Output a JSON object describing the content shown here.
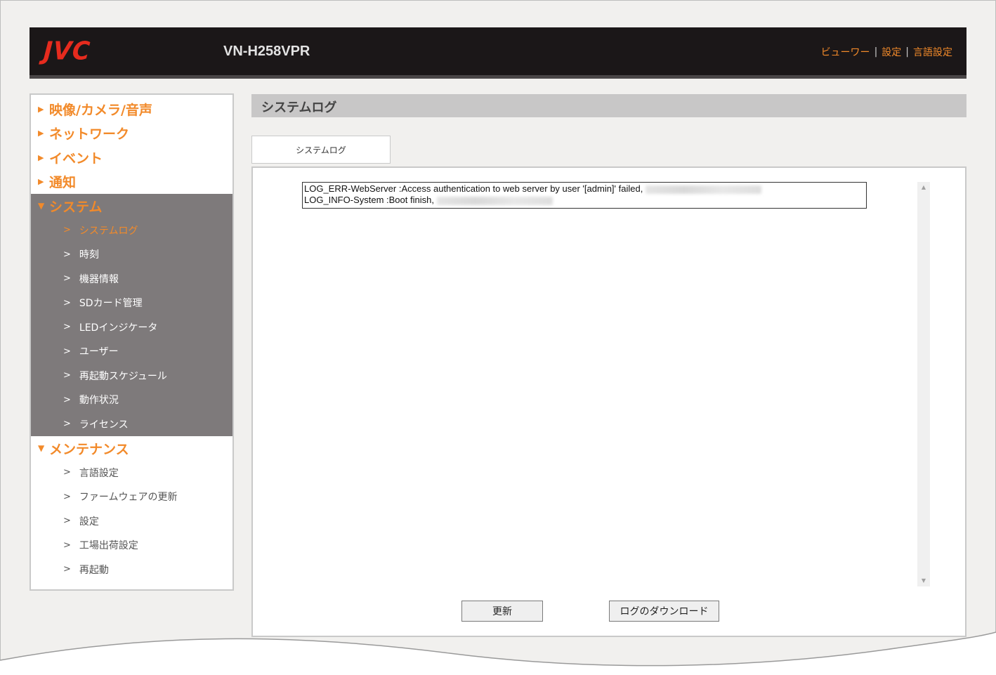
{
  "header": {
    "logo": "JVC",
    "model": "VN-H258VPR",
    "links": [
      "ビューワー",
      "設定",
      "言語設定"
    ],
    "separator": "|"
  },
  "sidebar": {
    "collapsed_marker": "▶",
    "expanded_marker": "▼",
    "sub_marker": ">",
    "sections_top": [
      {
        "label": "映像/カメラ/音声"
      },
      {
        "label": "ネットワーク"
      },
      {
        "label": "イベント"
      },
      {
        "label": "通知"
      }
    ],
    "system": {
      "label": "システム",
      "items": [
        "システムログ",
        "時刻",
        "機器情報",
        "SDカード管理",
        "LEDインジケータ",
        "ユーザー",
        "再起動スケジュール",
        "動作状況",
        "ライセンス"
      ],
      "active": "システムログ"
    },
    "maintenance": {
      "label": "メンテナンス",
      "items": [
        "言語設定",
        "ファームウェアの更新",
        "設定",
        "工場出荷設定",
        "再起動"
      ]
    }
  },
  "main": {
    "title": "システムログ",
    "tab": "システムログ",
    "log_lines": [
      "LOG_ERR-WebServer :Access authentication to web server by user '[admin]' failed,",
      "LOG_INFO-System :Boot finish,"
    ],
    "scroll_up": "▲",
    "scroll_down": "▼",
    "buttons": {
      "refresh": "更新",
      "download": "ログのダウンロード"
    }
  },
  "colors": {
    "accent": "#f28a2a",
    "header_bg": "#1b1718",
    "logo_red": "#e62b1e",
    "sidebar_active_bg": "#7e7a7b"
  }
}
